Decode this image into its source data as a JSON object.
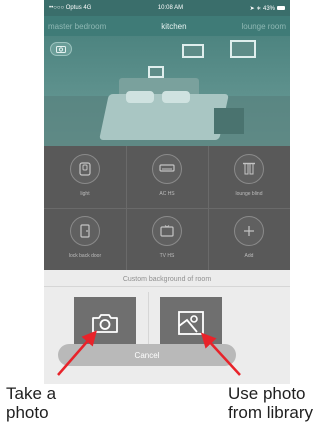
{
  "status_bar": {
    "carrier": "••○○○ Optus  4G",
    "time": "10:08 AM",
    "right": "➤ ∗ 43%"
  },
  "room_tabs": [
    {
      "label": "master bedroom",
      "active": false
    },
    {
      "label": "kitchen",
      "active": true
    },
    {
      "label": "lounge room",
      "active": false
    }
  ],
  "devices": [
    {
      "label": "light",
      "icon": "light-switch-icon"
    },
    {
      "label": "AC HS",
      "icon": "air-conditioner-icon"
    },
    {
      "label": "lounge blind",
      "icon": "blind-icon"
    },
    {
      "label": "lock back door",
      "icon": "door-icon"
    },
    {
      "label": "TV HS",
      "icon": "tv-icon"
    },
    {
      "label": "Add",
      "icon": "plus-icon"
    }
  ],
  "action_sheet": {
    "title": "Custom background of room",
    "take_photo_icon": "camera-icon",
    "library_icon": "photo-library-icon",
    "cancel_label": "Cancel"
  },
  "annotations": {
    "left_line1": "Take a",
    "left_line2": "photo",
    "right_line1": "Use photo",
    "right_line2": "from library",
    "arrow_color": "#e8232a"
  }
}
